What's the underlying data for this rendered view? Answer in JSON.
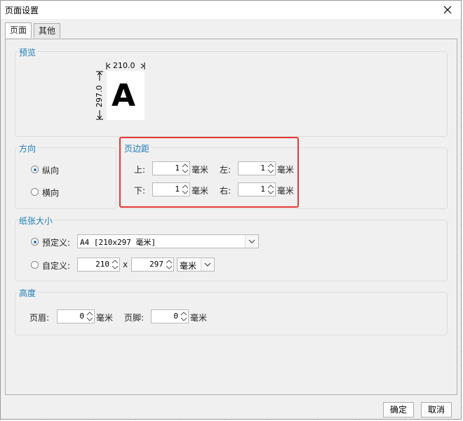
{
  "window": {
    "title": "页面设置",
    "close_icon": "close-icon"
  },
  "tabs": [
    {
      "label": "页面",
      "active": true
    },
    {
      "label": "其他",
      "active": false
    }
  ],
  "preview": {
    "title": "预览",
    "width_label": "210.0",
    "height_label": "297.0",
    "letter": "A"
  },
  "orientation": {
    "title": "方向",
    "options": [
      {
        "label": "纵向",
        "checked": true
      },
      {
        "label": "横向",
        "checked": false
      }
    ]
  },
  "margins": {
    "title": "页边距",
    "top": {
      "label": "上:",
      "value": "1",
      "unit": "毫米"
    },
    "left": {
      "label": "左:",
      "value": "1",
      "unit": "毫米"
    },
    "bottom": {
      "label": "下:",
      "value": "1",
      "unit": "毫米"
    },
    "right": {
      "label": "右:",
      "value": "1",
      "unit": "毫米"
    }
  },
  "paper": {
    "title": "纸张大小",
    "predefined": {
      "label": "预定义:",
      "checked": true,
      "value": "A4 [210x297 毫米]"
    },
    "custom": {
      "label": "自定义:",
      "checked": false,
      "width": "210",
      "x": "x",
      "height": "297",
      "unit": "毫米"
    }
  },
  "height": {
    "title": "高度",
    "header": {
      "label": "页眉:",
      "value": "0",
      "unit": "毫米"
    },
    "footer": {
      "label": "页脚:",
      "value": "0",
      "unit": "毫米"
    }
  },
  "buttons": {
    "ok": "确定",
    "cancel": "取消"
  },
  "colors": {
    "accent": "#1e7ab8",
    "highlight": "#e53935",
    "radio_dot": "#2a76c6"
  }
}
